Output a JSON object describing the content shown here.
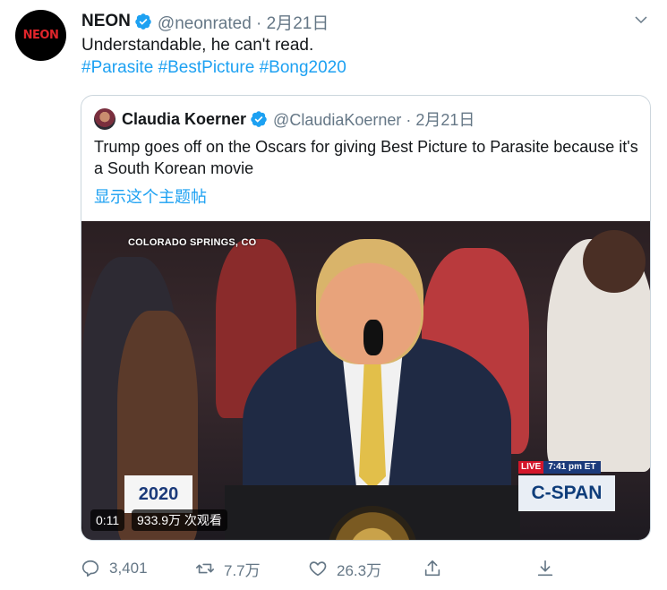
{
  "tweet": {
    "avatar_text": "NEON",
    "author_name": "NEON",
    "meta": "@neonrated · 2月21日",
    "text": "Understandable, he can't read.",
    "hashtags": [
      "#Parasite",
      "#BestPicture",
      "#Bong2020"
    ]
  },
  "quote": {
    "author_name": "Claudia Koerner",
    "meta": "@ClaudiaKoerner · 2月21日",
    "text": "Trump goes off on the Oscars for giving Best Picture to Parasite because it's a South Korean movie",
    "show_thread": "显示这个主题帖",
    "video": {
      "location": "COLORADO SPRINGS, CO",
      "live_label": "LIVE",
      "live_time": "7:41 pm ET",
      "network": "C-SPAN",
      "logo_text": "2020",
      "duration": "0:11",
      "views": "933.9万 次观看"
    }
  },
  "actions": {
    "reply_count": "3,401",
    "retweet_count": "7.7万",
    "like_count": "26.3万"
  },
  "colors": {
    "link": "#1da1f2",
    "muted": "#657786",
    "verified": "#1da1f2"
  },
  "icons": [
    "verified-icon",
    "chevron-down-icon",
    "reply-icon",
    "retweet-icon",
    "like-icon",
    "share-icon",
    "download-icon"
  ]
}
